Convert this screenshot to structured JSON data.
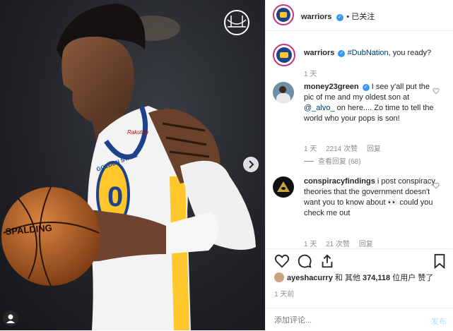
{
  "header": {
    "username": "warriors",
    "follow_status": "• 已关注"
  },
  "caption": {
    "username": "warriors",
    "hashtag": "#DubNation",
    "text": ", you ready?",
    "time": "1 天"
  },
  "comments": [
    {
      "username": "money23green",
      "mention": "@_alvo_",
      "text_before": "I see y'all put the pic of me and my oldest son at ",
      "text_after": " on here.... Zo time to tell the world who your pops is son!",
      "time": "1 天",
      "likes": "2214 次赞",
      "reply": "回复",
      "view_replies": "查看回复 (68)"
    },
    {
      "username": "conspiracyfindings",
      "text": "i post conspiracy theories that the government doesn't want you to know about 👀 could you check me out",
      "time": "1 天",
      "likes": "21 次赞",
      "reply": "回复"
    }
  ],
  "likes": {
    "user": "ayeshacurry",
    "connector": "和 其他",
    "count": "374,118",
    "suffix": "位用户 赞了"
  },
  "post_time": "1 天前",
  "add_comment": {
    "placeholder": "添加评论...",
    "publish": "发布"
  },
  "jersey_number": "0",
  "jersey_text": "GOLDEN STATE",
  "sponsor": "Rakuten",
  "ball_text": "SPALDING",
  "colors": {
    "accent": "#3897f0",
    "warriors_blue": "#1d428a",
    "warriors_gold": "#ffc72c"
  },
  "icons": [
    "heart-icon",
    "comment-icon",
    "share-icon",
    "bookmark-icon",
    "chevron-right-icon",
    "bridge-logo-icon"
  ]
}
